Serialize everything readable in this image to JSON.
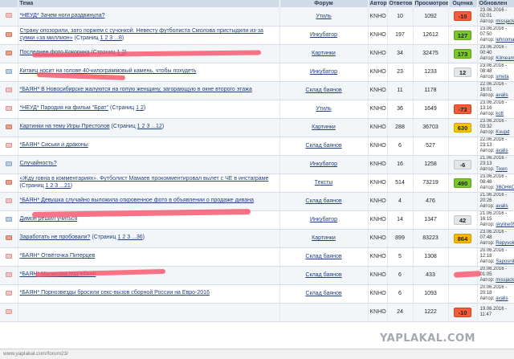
{
  "columns": {
    "topic": "Тема",
    "forum": "Форум",
    "author": "Автор",
    "replies": "Ответов",
    "views": "Просмотров",
    "rating": "Оценка",
    "updated": "Обновлен"
  },
  "author_label": "Автор:",
  "rows": [
    {
      "icon": "env-pink",
      "topic": "*НЕУД* Зачем ноги раздвинула?",
      "pages_prefix": "",
      "pages": "",
      "forum": "Утиль",
      "author": "KNHO",
      "replies": "10",
      "views": "1092",
      "rating": "-10",
      "rating_style": "neg",
      "upd_date": "23.06.2016 -",
      "upd_time": "02:01",
      "upd_user": "missjackson"
    },
    {
      "icon": "env-red",
      "topic": "Страну опозорили, зато поржем с сучонкой. Невесту футболиста Смолова пристыдили из-за сумки «за миллион»",
      "pages_prefix": "(Страниц",
      "pages": "1 2 3 ...8",
      "forum": "Инкубатор",
      "author": "KNHO",
      "replies": "197",
      "views": "12612",
      "rating": "127",
      "rating_style": "pos-green",
      "upd_date": "23.06.2016 -",
      "upd_time": "07:50",
      "upd_user": "lehnomaa"
    },
    {
      "icon": "env-red",
      "topic": "Последнее фото Кокорина",
      "pages_prefix": "(Страниц",
      "pages": "1 2",
      "forum": "Картинки",
      "author": "KNHO",
      "replies": "34",
      "views": "32475",
      "rating": "173",
      "rating_style": "pos-green",
      "upd_date": "23.06.2016 -",
      "upd_time": "00:40",
      "upd_user": "Kilmeamine"
    },
    {
      "icon": "env-blue",
      "topic": "Китаец носит на голове 40-килограммовый камень, чтобы похудеть",
      "pages_prefix": "",
      "pages": "",
      "forum": "Инкубатор",
      "author": "KNHO",
      "replies": "23",
      "views": "1233",
      "rating": "12",
      "rating_style": "neutral",
      "upd_date": "23.06.2016 -",
      "upd_time": "08:48",
      "upd_user": "smeta"
    },
    {
      "icon": "env-pink",
      "topic": "*БАЯН* В Новосибирске жалуются на голую женщину, загорающую в окне второго этажа",
      "pages_prefix": "",
      "pages": "",
      "forum": "Склад баянов",
      "author": "KNHO",
      "replies": "11",
      "views": "1178",
      "rating": "",
      "rating_style": "",
      "upd_date": "22.06.2016 -",
      "upd_time": "16:01",
      "upd_user": "avalis"
    },
    {
      "icon": "env-pink",
      "topic": "*НЕУД* Пародия на фильм \"Брат\"",
      "pages_prefix": "(Страниц",
      "pages": "1 2",
      "forum": "Утиль",
      "author": "KNHO",
      "replies": "36",
      "views": "1649",
      "rating": "-73",
      "rating_style": "neg",
      "upd_date": "23.06.2016 -",
      "upd_time": "13:16",
      "upd_user": "kott"
    },
    {
      "icon": "env-red",
      "topic": "Картинки на тему Игры Престолов",
      "pages_prefix": "(Страниц",
      "pages": "1 2 3 ...12",
      "forum": "Картинки",
      "author": "KNHO",
      "replies": "288",
      "views": "36703",
      "rating": "630",
      "rating_style": "pos-yellow",
      "upd_date": "23.06.2016 -",
      "upd_time": "03:32",
      "upd_user": "Kvupd"
    },
    {
      "icon": "env-pink",
      "topic": "*БАЯН* Сиськи и драконы",
      "pages_prefix": "",
      "pages": "",
      "forum": "Склад баянов",
      "author": "KNHO",
      "replies": "6",
      "views": "527",
      "rating": "",
      "rating_style": "",
      "upd_date": "22.06.2016 -",
      "upd_time": "23:13",
      "upd_user": "avalis"
    },
    {
      "icon": "env-blue",
      "topic": "Случайность?",
      "pages_prefix": "",
      "pages": "",
      "forum": "Инкубатор",
      "author": "KNHO",
      "replies": "16",
      "views": "1258",
      "rating": "-6",
      "rating_style": "neutral",
      "upd_date": "21.06.2016 -",
      "upd_time": "23:13",
      "upd_user": "Tixen"
    },
    {
      "icon": "env-red",
      "topic": "«Жду говна в комментариях». Футболист Мамаев прокомментировал вылет с ЧЕ в инстаграме",
      "pages_prefix": "(Страниц",
      "pages": "1 2 3 ...21",
      "forum": "Тексты",
      "author": "KNHO",
      "replies": "514",
      "views": "73219",
      "rating": "490",
      "rating_style": "pos-green",
      "upd_date": "23.06.2016 -",
      "upd_time": "08:48",
      "upd_user": "3ВОНКОВ"
    },
    {
      "icon": "env-pink",
      "topic": "*БАЯН* Девушка случайно выложила откровенное фото в объявлении о продаже дивана",
      "pages_prefix": "",
      "pages": "",
      "forum": "Склад баянов",
      "author": "KNHO",
      "replies": "4",
      "views": "476",
      "rating": "",
      "rating_style": "",
      "upd_date": "21.06.2016 -",
      "upd_time": "20:26",
      "upd_user": "avalis"
    },
    {
      "icon": "env-blue",
      "topic": "Димон решил учиться",
      "pages_prefix": "",
      "pages": "",
      "forum": "Инкубатор",
      "author": "KNHO",
      "replies": "14",
      "views": "1347",
      "rating": "42",
      "rating_style": "neutral",
      "upd_date": "21.06.2016 -",
      "upd_time": "16:15",
      "upd_user": "skyline0502"
    },
    {
      "icon": "env-red",
      "topic": "Заработать не пробовали?",
      "pages_prefix": "(Страниц",
      "pages": "1 2 3 ...36",
      "forum": "Картинки",
      "author": "KNHO",
      "replies": "899",
      "views": "83223",
      "rating": "864",
      "rating_style": "hot",
      "upd_date": "23.06.2016 -",
      "upd_time": "07:48",
      "upd_user": "Repyvok"
    },
    {
      "icon": "env-pink",
      "topic": "*БАЯН* Отвёточка Питерцев",
      "pages_prefix": "",
      "pages": "",
      "forum": "Склад баянов",
      "author": "KNHO",
      "replies": "5",
      "views": "1308",
      "rating": "",
      "rating_style": "",
      "upd_date": "20.06.2016 -",
      "upd_time": "12:18",
      "upd_user": "Saposnik"
    },
    {
      "icon": "env-pink",
      "topic": "*БАЯН* Малахова под\"ебали",
      "pages_prefix": "",
      "pages": "",
      "forum": "Склад баянов",
      "author": "KNHO",
      "replies": "6",
      "views": "433",
      "rating": "",
      "rating_style": "",
      "upd_date": "20.06.2016 -",
      "upd_time": "01:05",
      "upd_user": "missjackson"
    },
    {
      "icon": "env-pink",
      "topic": "*БАЯН* Порнозвезды бросили секс-вызов сборной России на Евро-2016",
      "pages_prefix": "",
      "pages": "",
      "forum": "Склад баянов",
      "author": "KNHO",
      "replies": "6",
      "views": "1093",
      "rating": "",
      "rating_style": "",
      "upd_date": "20.06.2016 -",
      "upd_time": "20:18",
      "upd_user": "avalis"
    },
    {
      "icon": "env-pink",
      "topic": "",
      "pages_prefix": "",
      "pages": "",
      "forum": "",
      "author": "KNHO",
      "replies": "24",
      "views": "1222",
      "rating": "-10",
      "rating_style": "neg",
      "upd_date": "19.06.2016 -",
      "upd_time": "11:47",
      "upd_user": ""
    }
  ],
  "status_bar": {
    "url": "www.yaplakal.com/forum23/"
  },
  "watermark": "YAPLAKAL.COM"
}
